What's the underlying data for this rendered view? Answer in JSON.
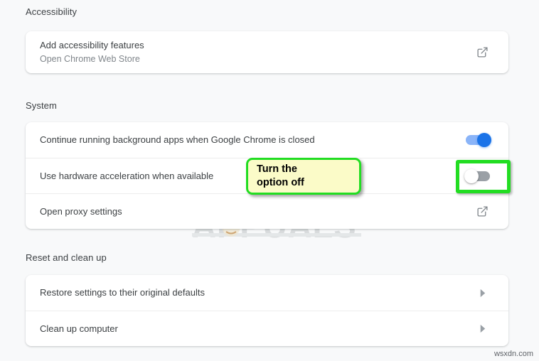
{
  "page": {
    "background_color": "#f8f9fa",
    "card_background": "#ffffff"
  },
  "sections": [
    {
      "id": "accessibility",
      "title": "Accessibility",
      "rows": [
        {
          "label": "Add accessibility features",
          "sub_label": "Open Chrome Web Store",
          "action": "external-link-icon"
        }
      ]
    },
    {
      "id": "system",
      "title": "System",
      "rows": [
        {
          "label": "Continue running background apps when Google Chrome is closed",
          "action": "toggle",
          "toggle_state": "on"
        },
        {
          "label": "Use hardware acceleration when available",
          "action": "toggle",
          "toggle_state": "off"
        },
        {
          "label": "Open proxy settings",
          "action": "external-link-icon"
        }
      ]
    },
    {
      "id": "reset-and-clean-up",
      "title": "Reset and clean up",
      "rows": [
        {
          "label": "Restore settings to their original defaults",
          "action": "chevron-right-icon"
        },
        {
          "label": "Clean up computer",
          "action": "chevron-right-icon"
        }
      ]
    }
  ],
  "annotations": {
    "callout": {
      "line1": "Turn the",
      "line2": "option off",
      "fill_color": "#fbfbc8",
      "border_color": "#22dd22"
    },
    "highlight": {
      "border_color": "#22dd22",
      "target": "hardware-acceleration-toggle"
    }
  },
  "watermarks": {
    "brand": "APPUALS",
    "site": "wsxdn.com"
  },
  "colors": {
    "toggle_on_track": "#8ab4f8",
    "toggle_on_knob": "#1a73e8",
    "toggle_off_track": "#9aa0a6",
    "toggle_off_knob": "#ffffff",
    "primary_text": "#3c4043",
    "secondary_text": "#80868b"
  }
}
